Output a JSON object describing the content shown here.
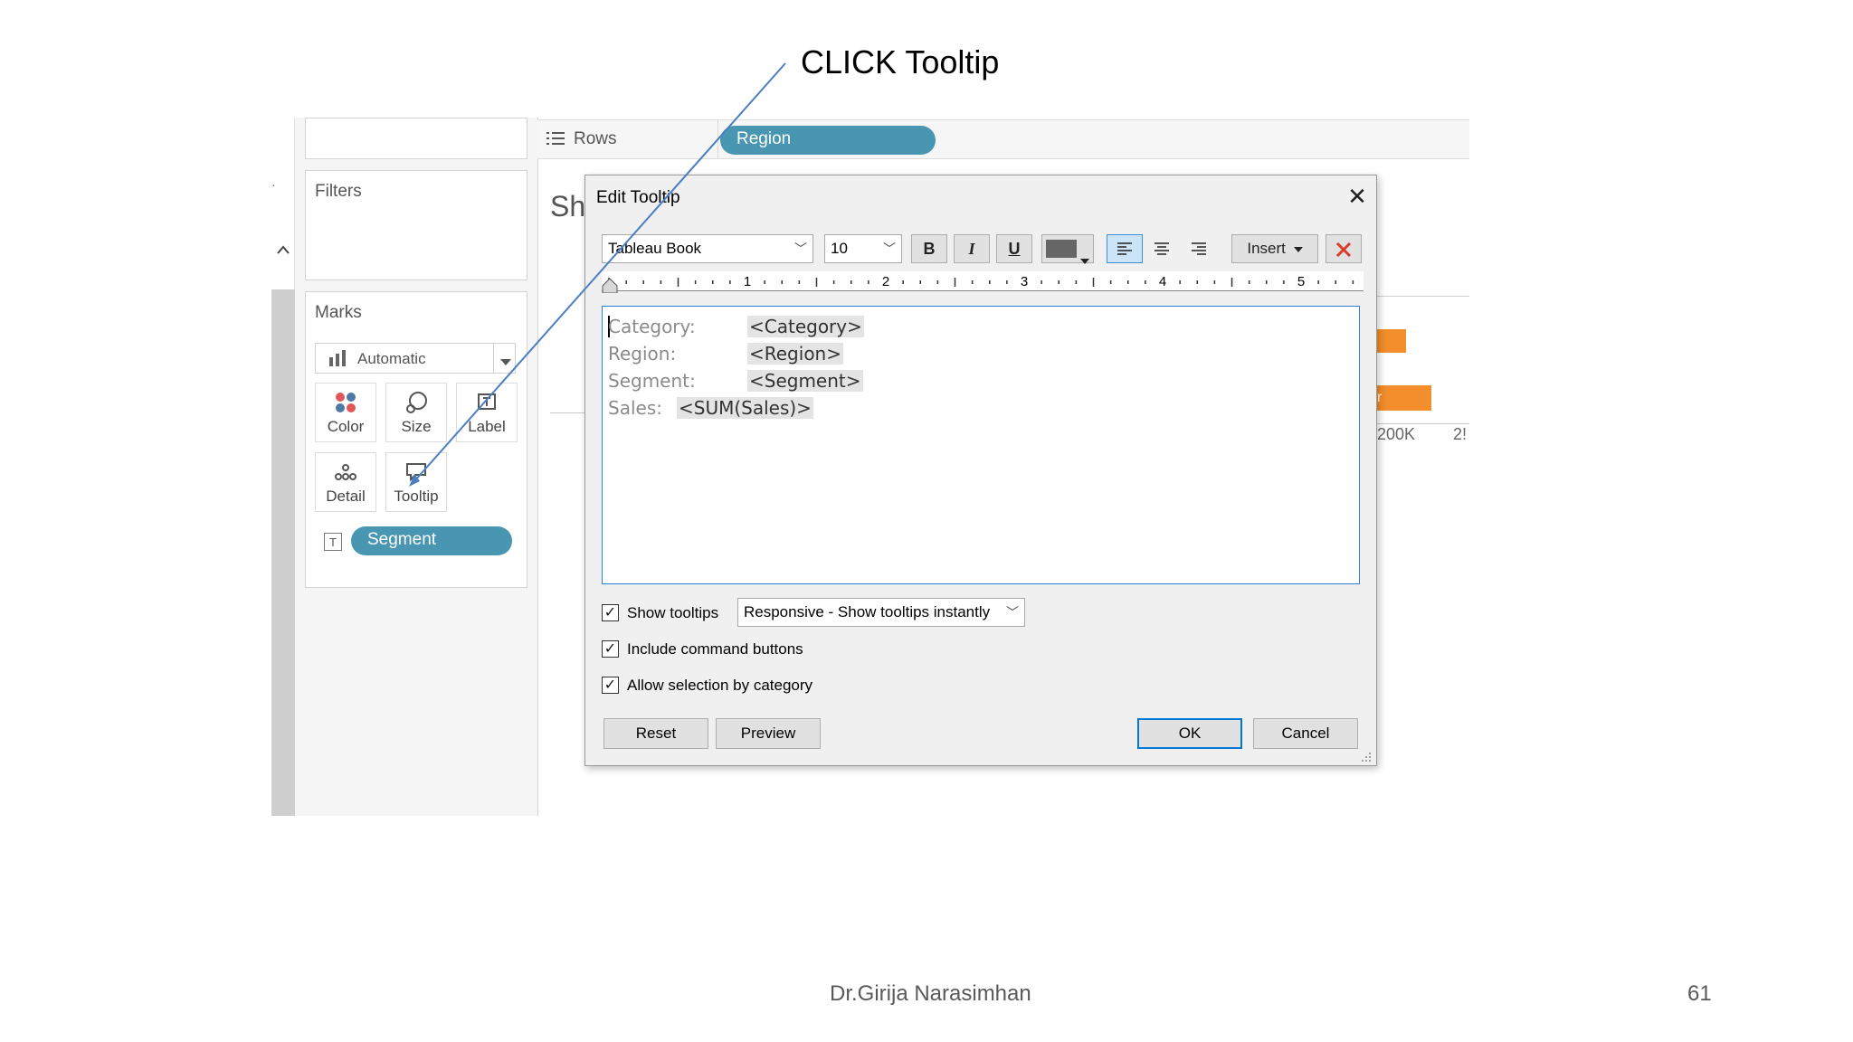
{
  "callout": "CLICK Tooltip",
  "footer": {
    "author": "Dr.Girija Narasimhan",
    "page": "61"
  },
  "tableau": {
    "filters_title": "Filters",
    "marks_title": "Marks",
    "mark_type": "Automatic",
    "mark_buttons": [
      {
        "label": "Color",
        "icon": "color-dots-icon"
      },
      {
        "label": "Size",
        "icon": "size-icon"
      },
      {
        "label": "Label",
        "icon": "label-icon"
      },
      {
        "label": "Detail",
        "icon": "detail-icon"
      },
      {
        "label": "Tooltip",
        "icon": "tooltip-icon"
      }
    ],
    "segment_pill": "Segment",
    "rows_label": "Rows",
    "region_pill": "Region",
    "sheet_title_fragment": "Sh",
    "axis_fragments": [
      "200K",
      "2!"
    ],
    "bar_fragment": "r",
    "bar_color": "#f28e2b"
  },
  "dialog": {
    "title": "Edit Tooltip",
    "font_name": "Tableau Book",
    "font_size": "10",
    "bold": "B",
    "italic": "I",
    "underline": "U",
    "insert": "Insert",
    "ruler_numbers": [
      "1",
      "2",
      "3",
      "4",
      "5"
    ],
    "fields": [
      {
        "label": "Category:",
        "value": "<Category>"
      },
      {
        "label": "Region:",
        "value": "<Region>"
      },
      {
        "label": "Segment:",
        "value": "<Segment>"
      },
      {
        "label": "Sales:",
        "value": "<SUM(Sales)>"
      }
    ],
    "show_tooltips": {
      "label": "Show tooltips",
      "checked": true
    },
    "tooltip_mode": "Responsive - Show tooltips instantly",
    "include_buttons": {
      "label": "Include command buttons",
      "checked": true
    },
    "allow_selection": {
      "label": "Allow selection by category",
      "checked": true
    },
    "buttons": {
      "reset": "Reset",
      "preview": "Preview",
      "ok": "OK",
      "cancel": "Cancel"
    }
  }
}
